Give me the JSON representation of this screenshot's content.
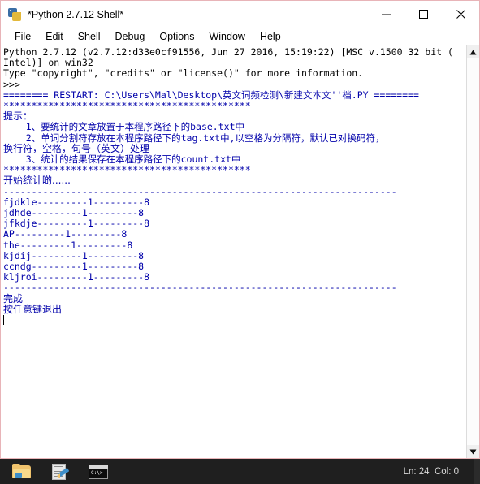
{
  "window": {
    "title": "*Python 2.7.12 Shell*",
    "icon": "python-idle-icon",
    "caption": {
      "minimize": "—",
      "maximize": "□",
      "close": "✕"
    }
  },
  "menubar": {
    "items": [
      {
        "name": "file",
        "accel": "F",
        "rest": "ile"
      },
      {
        "name": "edit",
        "accel": "E",
        "rest": "dit"
      },
      {
        "name": "shell",
        "accel": "S",
        "rest": "hell"
      },
      {
        "name": "debug",
        "accel": "D",
        "rest": "ebug"
      },
      {
        "name": "options",
        "accel": "O",
        "rest": "ptions"
      },
      {
        "name": "window",
        "accel": "W",
        "rest": "indow"
      },
      {
        "name": "help",
        "accel": "H",
        "rest": "elp"
      }
    ]
  },
  "shell": {
    "lines": [
      {
        "text": "Python 2.7.12 (v2.7.12:d33e0cf91556, Jun 27 2016, 15:19:22) [MSC v.1500 32 bit (",
        "style": "black"
      },
      {
        "text": "Intel)] on win32",
        "style": "black"
      },
      {
        "text": "Type \"copyright\", \"credits\" or \"license()\" for more information.",
        "style": "black"
      },
      {
        "text": ">>>",
        "style": "black"
      },
      {
        "text": "======== RESTART: C:\\Users\\Mal\\Desktop\\英文词频检测\\新建文本文''档.PY ========",
        "style": "blue-mixed"
      },
      {
        "text": "********************************************",
        "style": "blue"
      },
      {
        "text": "提示：",
        "style": "blue-cjk"
      },
      {
        "text": "    1、要统计的文章放置于本程序路径下的base.txt中",
        "style": "blue-mixed"
      },
      {
        "text": "    2、单词分割符存放在本程序路径下的tag.txt中,以空格为分隔符，默认已对换码符，",
        "style": "blue-mixed"
      },
      {
        "text": "换行符，空格，句号（英文）处理",
        "style": "blue-cjk"
      },
      {
        "text": "    3、统计的结果保存在本程序路径下的count.txt中",
        "style": "blue-mixed"
      },
      {
        "text": "********************************************",
        "style": "blue"
      },
      {
        "text": "开始统计啲......",
        "style": "blue-cjk"
      },
      {
        "text": "----------------------------------------------------------------------",
        "style": "blue"
      },
      {
        "text": "fjdkle---------1---------8",
        "style": "blue"
      },
      {
        "text": "jdhde---------1---------8",
        "style": "blue"
      },
      {
        "text": "jfkdje---------1---------8",
        "style": "blue"
      },
      {
        "text": "AP---------1---------8",
        "style": "blue"
      },
      {
        "text": "the---------1---------8",
        "style": "blue"
      },
      {
        "text": "kjdij---------1---------8",
        "style": "blue"
      },
      {
        "text": "ccndg---------1---------8",
        "style": "blue"
      },
      {
        "text": "kljroi---------1---------8",
        "style": "blue"
      },
      {
        "text": "----------------------------------------------------------------------",
        "style": "blue"
      },
      {
        "text": "完成",
        "style": "blue-cjk"
      },
      {
        "text": "按任意键退出",
        "style": "blue-cjk"
      }
    ]
  },
  "scrollbar": {
    "up_arrow": "scroll-up-arrow",
    "down_arrow": "scroll-down-arrow"
  },
  "taskbar": {
    "icons": [
      {
        "name": "file-explorer-icon"
      },
      {
        "name": "text-editor-icon"
      },
      {
        "name": "command-prompt-icon"
      }
    ],
    "cmd_prompt_text": "C:\\>",
    "status": "Ln: 24  Col: 0"
  },
  "colors": {
    "shell_blue": "#0000aa",
    "shell_black": "#000000",
    "window_border": "#e8b4b8",
    "taskbar_bg": "#1f1f1f"
  }
}
